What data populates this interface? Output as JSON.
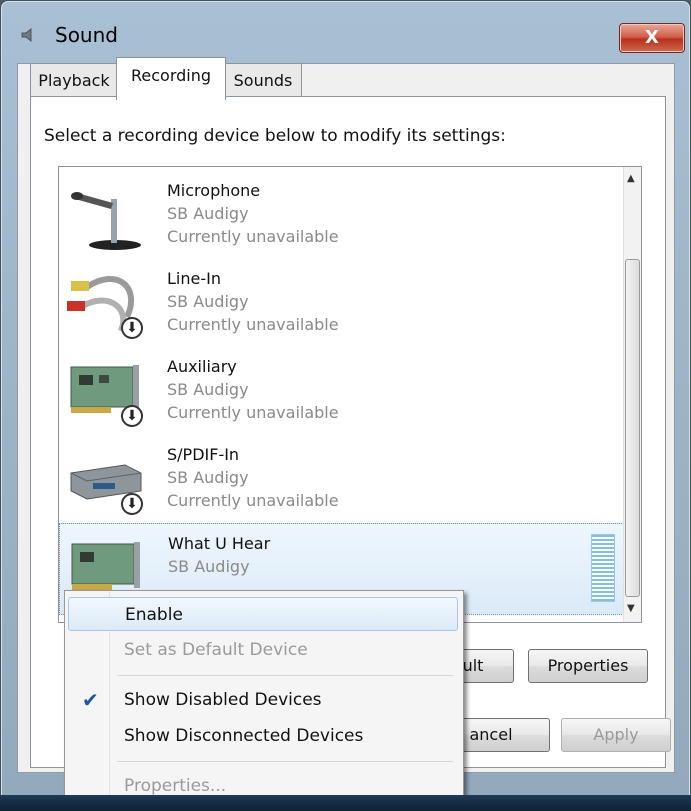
{
  "window": {
    "title": "Sound",
    "close_label": "X"
  },
  "tabs": [
    {
      "label": "Playback"
    },
    {
      "label": "Recording"
    },
    {
      "label": "Sounds"
    }
  ],
  "instruction": "Select a recording device below to modify its settings:",
  "devices": [
    {
      "name": "Microphone",
      "driver": "SB Audigy",
      "status": "Currently unavailable",
      "icon": "microphone-icon"
    },
    {
      "name": "Line-In",
      "driver": "SB Audigy",
      "status": "Currently unavailable",
      "icon": "rca-cable-icon"
    },
    {
      "name": "Auxiliary",
      "driver": "SB Audigy",
      "status": "Currently unavailable",
      "icon": "sound-card-icon"
    },
    {
      "name": "S/PDIF-In",
      "driver": "SB Audigy",
      "status": "Currently unavailable",
      "icon": "spdif-device-icon"
    },
    {
      "name": "What U Hear",
      "driver": "SB Audigy",
      "status": "",
      "icon": "sound-card-icon"
    }
  ],
  "buttons": {
    "set_default": "ult",
    "properties": "Properties",
    "cancel": "ancel",
    "apply": "Apply"
  },
  "context_menu": {
    "enable": "Enable",
    "set_default": "Set as Default Device",
    "show_disabled": "Show Disabled Devices",
    "show_disconnected": "Show Disconnected Devices",
    "properties": "Properties...",
    "checkmark": "✔"
  }
}
